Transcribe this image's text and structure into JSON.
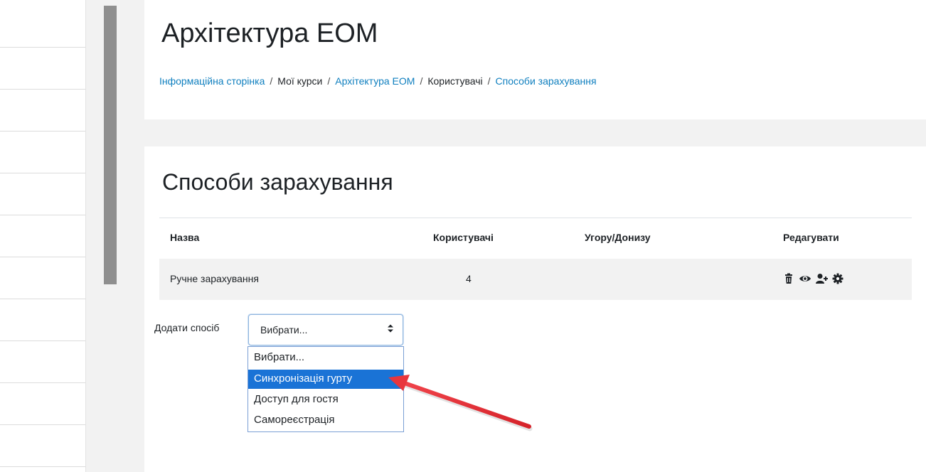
{
  "page": {
    "title": "Архітектура ЕОМ",
    "breadcrumb": [
      {
        "label": "Інформаційна сторінка",
        "link": true
      },
      {
        "label": "Мої курси",
        "link": false
      },
      {
        "label": "Архітектура ЕОМ",
        "link": true
      },
      {
        "label": "Користувачі",
        "link": false
      },
      {
        "label": "Способи зарахування",
        "link": true
      }
    ],
    "separator": "/"
  },
  "enrolment": {
    "title": "Способи зарахування",
    "columns": {
      "name": "Назва",
      "users": "Користувачі",
      "updown": "Угору/Донизу",
      "edit": "Редагувати"
    },
    "rows": [
      {
        "name": "Ручне зарахування",
        "users": "4",
        "actions": [
          "trash-icon",
          "eye-icon",
          "enrol-user-icon",
          "gear-icon"
        ]
      }
    ]
  },
  "add_method": {
    "label": "Додати спосіб",
    "selected": "Вибрати...",
    "options": [
      "Вибрати...",
      "Синхронізація гурту",
      "Доступ для гостя",
      "Самореєстрація"
    ],
    "highlighted_option": "Синхронізація гурту"
  },
  "colors": {
    "link": "#0f7fbf",
    "highlight": "#1a73d6",
    "annotation_arrow": "#e8363d"
  }
}
